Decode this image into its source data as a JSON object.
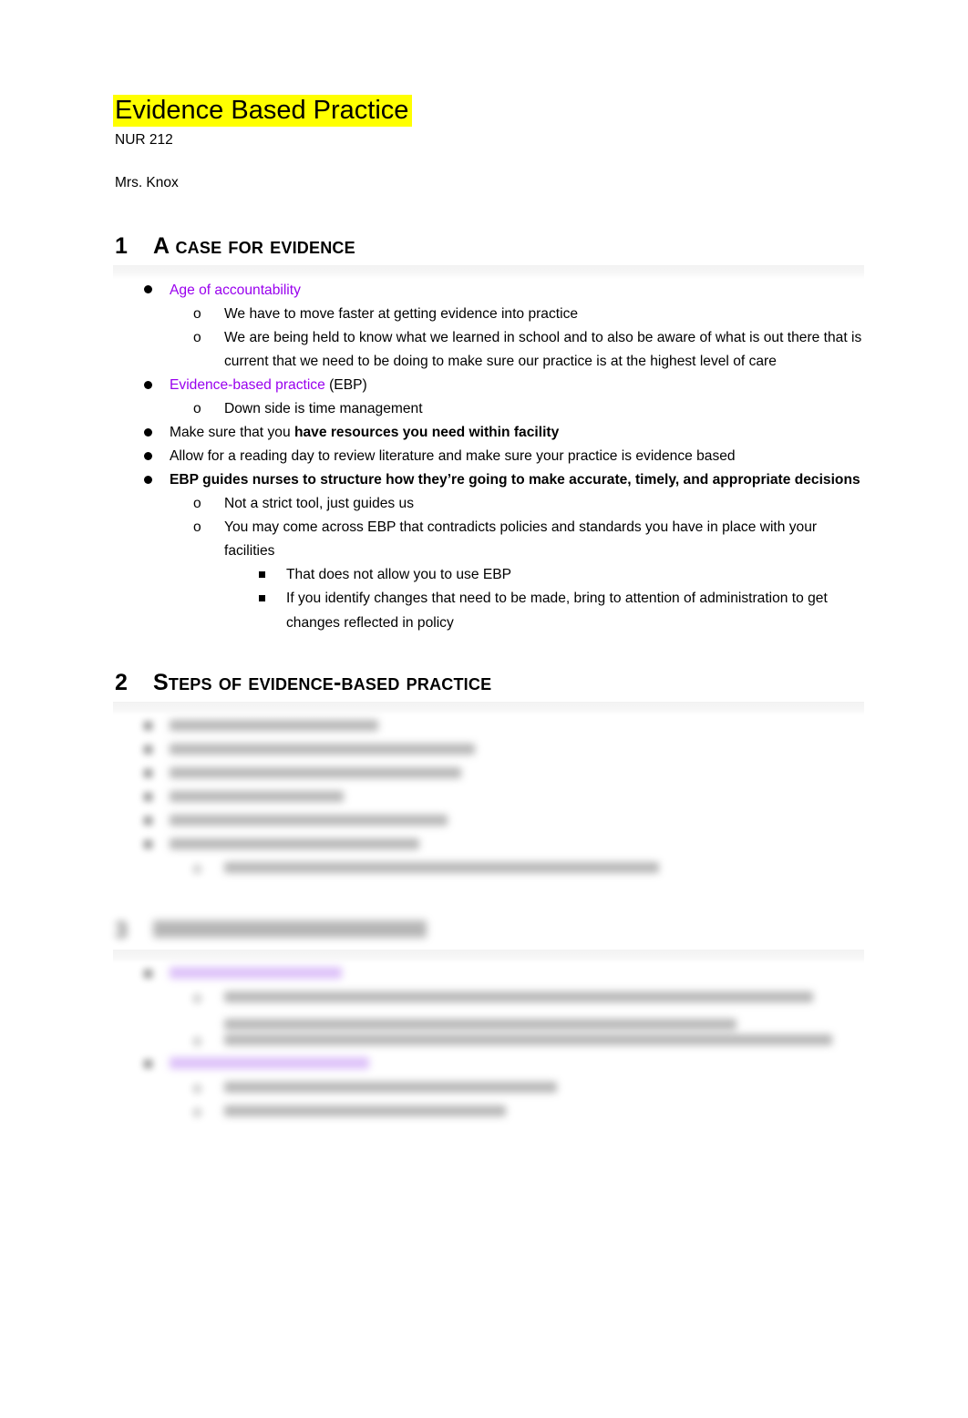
{
  "document": {
    "title": "Evidence Based Practice",
    "course": "NUR 212",
    "instructor": "Mrs. Knox",
    "title_highlight_color": "#ffff00",
    "accent_color": "#9900ee",
    "violet_highlight_color": "#c89bf5"
  },
  "sections": [
    {
      "number": "1",
      "heading": "A case for evidence",
      "blurred": false,
      "items": [
        {
          "level": 1,
          "marker": "disc",
          "runs": [
            {
              "text": "Age of accountability",
              "style": "purple"
            }
          ]
        },
        {
          "level": 2,
          "marker": "o",
          "runs": [
            {
              "text": "We have to move faster at getting evidence into practice",
              "style": "normal"
            }
          ]
        },
        {
          "level": 2,
          "marker": "o",
          "runs": [
            {
              "text": "We are being held to know what we learned in school and to also be aware of what is out there that is current that we need to be doing to make sure our practice is at the highest level of care",
              "style": "normal"
            }
          ]
        },
        {
          "level": 1,
          "marker": "disc",
          "runs": [
            {
              "text": "Evidence-based practice",
              "style": "purple"
            },
            {
              "text": " (EBP)",
              "style": "normal"
            }
          ]
        },
        {
          "level": 2,
          "marker": "o",
          "runs": [
            {
              "text": "Down side is time management",
              "style": "normal"
            }
          ]
        },
        {
          "level": 1,
          "marker": "disc",
          "runs": [
            {
              "text": "Make sure that you ",
              "style": "normal"
            },
            {
              "text": "have resources you need within facility",
              "style": "bold"
            }
          ]
        },
        {
          "level": 1,
          "marker": "disc",
          "runs": [
            {
              "text": "Allow for a reading day to review literature and make sure your practice is evidence based",
              "style": "normal"
            }
          ]
        },
        {
          "level": 1,
          "marker": "disc",
          "runs": [
            {
              "text": "EBP guides nurses to structure how they’re going to make accurate, timely, and appropriate decisions",
              "style": "bold"
            }
          ]
        },
        {
          "level": 2,
          "marker": "o",
          "runs": [
            {
              "text": "Not a strict tool, just guides us",
              "style": "normal"
            }
          ]
        },
        {
          "level": 2,
          "marker": "o",
          "runs": [
            {
              "text": "You may come across EBP that contradicts policies and standards you have in place with your facilities",
              "style": "normal"
            }
          ]
        },
        {
          "level": 3,
          "marker": "square",
          "runs": [
            {
              "text": "That does not allow you to use EBP",
              "style": "normal"
            }
          ]
        },
        {
          "level": 3,
          "marker": "square",
          "runs": [
            {
              "text": "If you identify changes that need to be made, bring to attention of administration to get changes reflected in policy",
              "style": "normal"
            }
          ]
        }
      ]
    },
    {
      "number": "2",
      "heading": "Steps of Evidence-Based practice",
      "blurred": false,
      "items": []
    }
  ],
  "locked_preview": {
    "note_visible": false,
    "blocks": [
      {
        "kind": "list",
        "items": [
          {
            "level": 1,
            "marker": "disc",
            "width": "30%",
            "highlight": "none"
          },
          {
            "level": 1,
            "marker": "disc",
            "width": "44%",
            "highlight": "none"
          },
          {
            "level": 1,
            "marker": "disc",
            "width": "42%",
            "highlight": "none"
          },
          {
            "level": 1,
            "marker": "disc",
            "width": "25%",
            "highlight": "none"
          },
          {
            "level": 1,
            "marker": "disc",
            "width": "40%",
            "highlight": "none"
          },
          {
            "level": 1,
            "marker": "disc",
            "width": "36%",
            "highlight": "none"
          },
          {
            "level": 2,
            "marker": "o",
            "width": "68%",
            "highlight": "none"
          }
        ]
      },
      {
        "kind": "heading",
        "number": "3",
        "width": "36%"
      },
      {
        "kind": "list",
        "items": [
          {
            "level": 1,
            "marker": "disc",
            "width": "24%",
            "highlight": "violet"
          },
          {
            "level": 2,
            "marker": "o",
            "width": "92%",
            "highlight": "none"
          },
          {
            "level": 2,
            "marker": "o",
            "width": "95%",
            "highlight": "none"
          },
          {
            "level": 1,
            "marker": "disc",
            "width": "28%",
            "highlight": "violet"
          },
          {
            "level": 2,
            "marker": "o",
            "width": "52%",
            "highlight": "none"
          },
          {
            "level": 2,
            "marker": "o",
            "width": "44%",
            "highlight": "none"
          }
        ]
      }
    ]
  }
}
